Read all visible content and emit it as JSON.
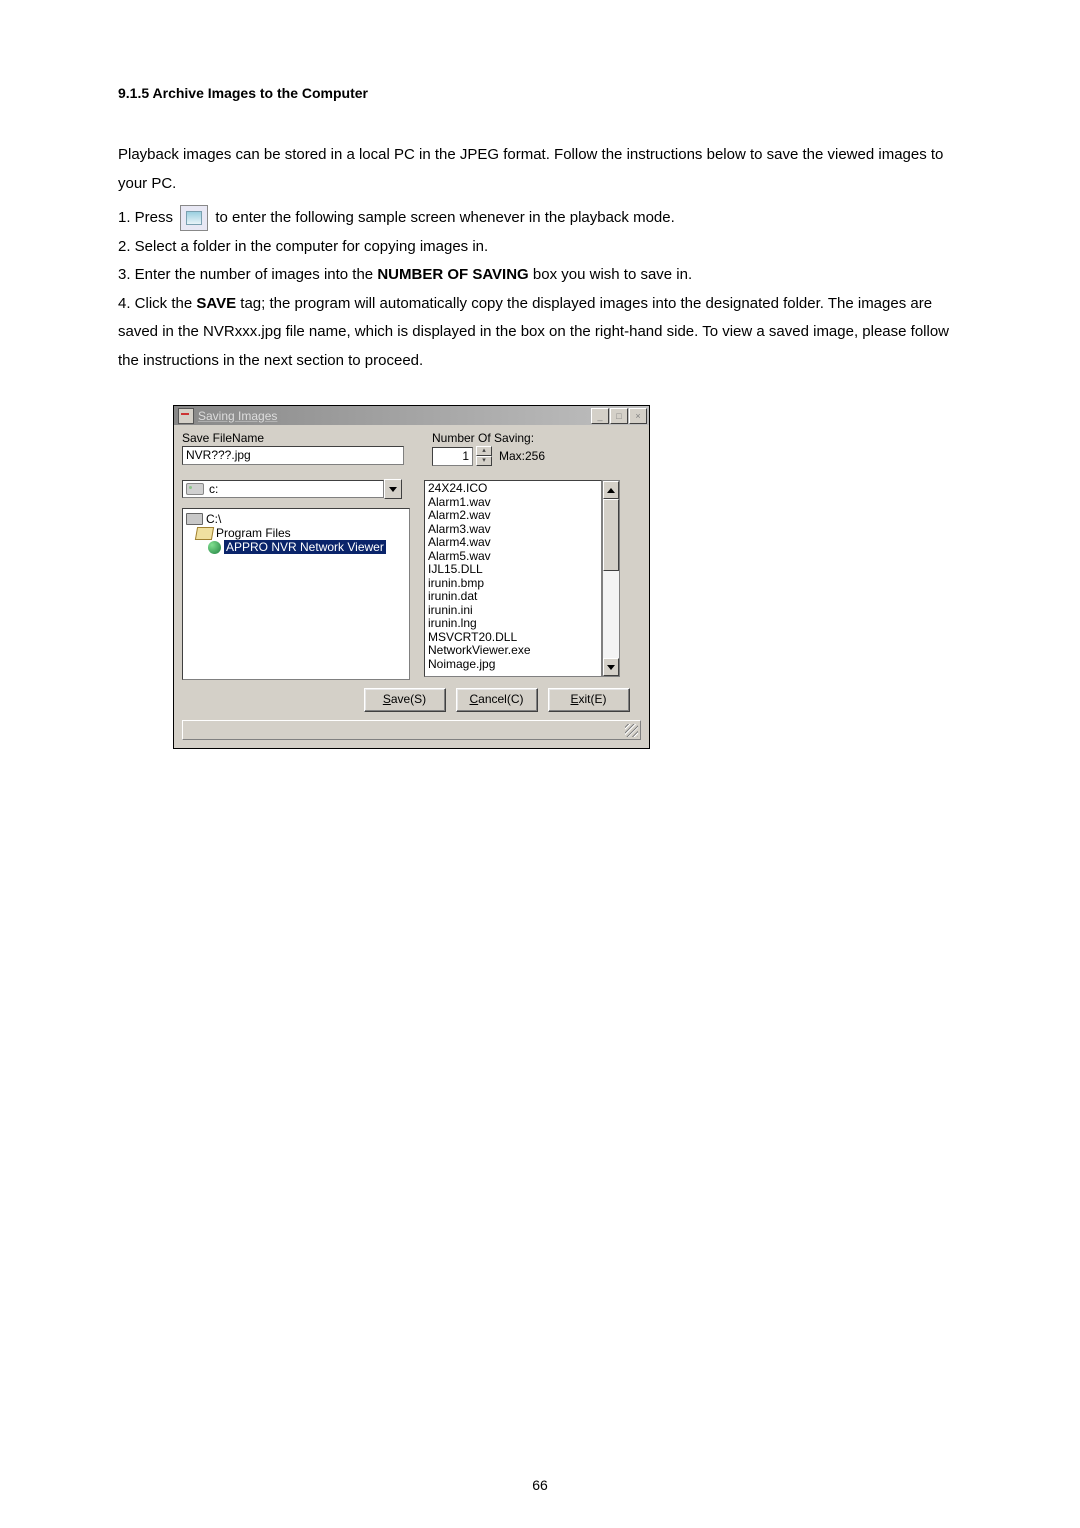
{
  "heading": "9.1.5 Archive Images to the Computer",
  "para1": "Playback images can be stored in a local PC in the JPEG format. Follow the instructions below to save the viewed images to your PC.",
  "step1a": "1. Press ",
  "step1b": " to enter the following sample screen whenever in the playback mode.",
  "step2": "2. Select a folder in the computer for copying images in.",
  "step3a": "3. Enter the number of images into the ",
  "step3bold": "NUMBER OF SAVING",
  "step3b": " box you wish to save in.",
  "step4a": "4. Click the ",
  "step4bold": "SAVE",
  "step4b": " tag; the program will automatically copy the displayed images into the designated folder. The images are saved in the NVRxxx.jpg file name, which is displayed in the box on the right-hand side. To view a saved image, please follow the instructions in the next section to proceed.",
  "dialog": {
    "title": "Saving Images",
    "save_filename_label": "Save FileName",
    "save_filename_value": "NVR???.jpg",
    "number_label": "Number Of Saving:",
    "number_value": "1",
    "max_label": "Max:256",
    "drive_label": "c:",
    "tree": {
      "c": "C:\\",
      "pf": "Program Files",
      "app": "APPRO NVR Network Viewer"
    },
    "files": [
      "24X24.ICO",
      "Alarm1.wav",
      "Alarm2.wav",
      "Alarm3.wav",
      "Alarm4.wav",
      "Alarm5.wav",
      "IJL15.DLL",
      "irunin.bmp",
      "irunin.dat",
      "irunin.ini",
      "irunin.lng",
      "MSVCRT20.DLL",
      "NetworkViewer.exe",
      "Noimage.jpg"
    ],
    "save_btn": "Save(S)",
    "cancel_btn": "Cancel(C)",
    "exit_btn": "Exit(E)"
  },
  "page_number": "66"
}
